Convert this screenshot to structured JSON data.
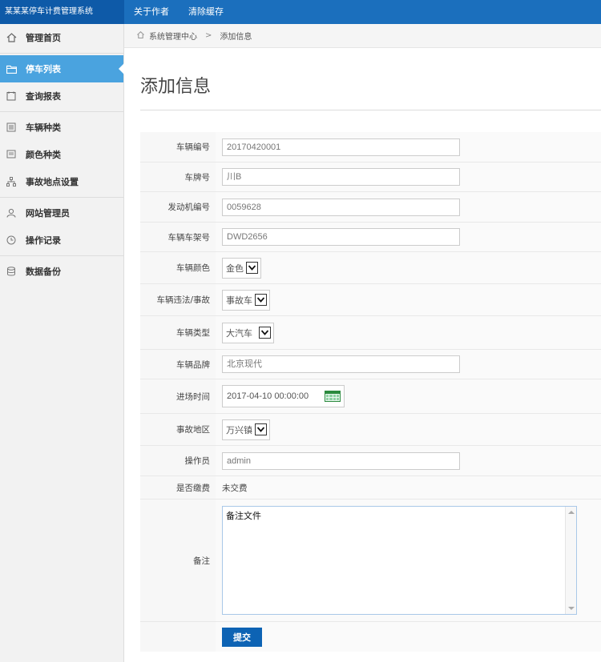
{
  "app": {
    "title": "某某某停车计费管理系统"
  },
  "topnav": {
    "items": [
      "关于作者",
      "清除缓存"
    ]
  },
  "sidebar": {
    "items": [
      {
        "label": "管理首页",
        "icon": "home-icon"
      },
      {
        "label": "停车列表",
        "icon": "folder-icon",
        "active": true
      },
      {
        "label": "查询报表",
        "icon": "calendar-icon"
      },
      {
        "label": "车辆种类",
        "icon": "list-icon"
      },
      {
        "label": "颜色种类",
        "icon": "palette-icon"
      },
      {
        "label": "事故地点设置",
        "icon": "sitemap-icon"
      },
      {
        "label": "网站管理员",
        "icon": "user-icon"
      },
      {
        "label": "操作记录",
        "icon": "clock-icon"
      },
      {
        "label": "数据备份",
        "icon": "database-icon"
      }
    ]
  },
  "breadcrumb": {
    "root": "系统管理中心",
    "separator": ">",
    "current": "添加信息"
  },
  "page": {
    "title": "添加信息"
  },
  "form": {
    "vehicle_no": {
      "label": "车辆编号",
      "value": "20170420001"
    },
    "plate_no": {
      "label": "车牌号",
      "value": "川B"
    },
    "engine_no": {
      "label": "发动机编号",
      "value": "0059628"
    },
    "frame_no": {
      "label": "车辆车架号",
      "value": "DWD2656"
    },
    "color": {
      "label": "车辆颜色",
      "value": "金色"
    },
    "violation": {
      "label": "车辆违法/事故",
      "value": "事故车"
    },
    "vehicle_type": {
      "label": "车辆类型",
      "value": "大汽车"
    },
    "brand": {
      "label": "车辆品牌",
      "value": "北京现代"
    },
    "entry_time": {
      "label": "进场时间",
      "value": "2017-04-10 00:00:00"
    },
    "accident_area": {
      "label": "事故地区",
      "value": "万兴镇"
    },
    "operator": {
      "label": "操作员",
      "value": "admin"
    },
    "paid": {
      "label": "是否缴费",
      "value": "未交费"
    },
    "remark": {
      "label": "备注",
      "value": "备注文件"
    },
    "submit_label": "提交"
  },
  "colors": {
    "topbar": "#1b6fbd",
    "active": "#4aa3df",
    "button": "#0d63b4"
  }
}
